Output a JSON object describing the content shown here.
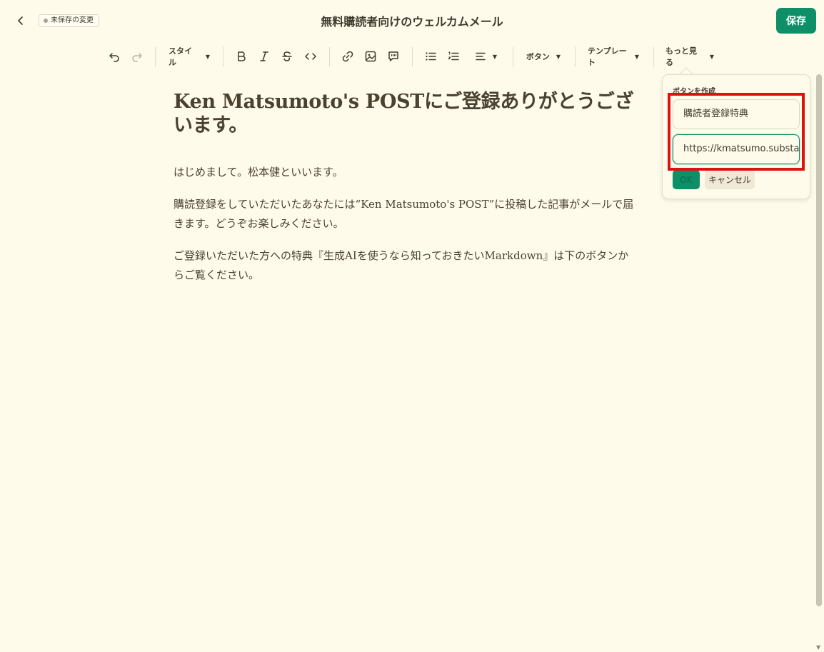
{
  "header": {
    "unsaved_label": "未保存の変更",
    "title": "無料購読者向けのウェルカムメール",
    "save_label": "保存"
  },
  "toolbar": {
    "style_label": "スタイル",
    "button_label": "ボタン",
    "template_label": "テンプレート",
    "more_label": "もっと見る"
  },
  "editor": {
    "heading": "Ken Matsumoto's POSTにご登録ありがとうございます。",
    "paragraphs": [
      "はじめまして。松本健といいます。",
      "購読登録をしていただいたあなたには“Ken Matsumoto's POST”に投稿した記事がメールで届きます。どうぞお楽しみください。",
      "ご登録いただいた方への特典『生成AIを使うなら知っておきたいMarkdown』は下のボタンからご覧ください。"
    ]
  },
  "popover": {
    "title": "ボタンを作成",
    "label_value": "購読者登録特典",
    "url_value": "https://kmatsumo.substa",
    "ok_label": "OK",
    "cancel_label": "キャンセル"
  },
  "colors": {
    "background": "#fffbea",
    "accent": "#0e8f68",
    "highlight": "#dd1111"
  }
}
